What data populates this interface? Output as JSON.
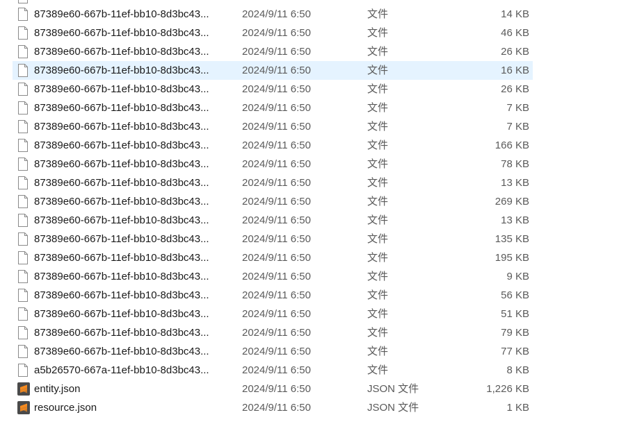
{
  "files": [
    {
      "name": "",
      "date": "",
      "type": "",
      "size": "",
      "icon": "document-icon",
      "partial": true
    },
    {
      "name": "87389e60-667b-11ef-bb10-8d3bc43...",
      "date": "2024/9/11 6:50",
      "type": "文件",
      "size": "14 KB",
      "icon": "document-icon"
    },
    {
      "name": "87389e60-667b-11ef-bb10-8d3bc43...",
      "date": "2024/9/11 6:50",
      "type": "文件",
      "size": "46 KB",
      "icon": "document-icon"
    },
    {
      "name": "87389e60-667b-11ef-bb10-8d3bc43...",
      "date": "2024/9/11 6:50",
      "type": "文件",
      "size": "26 KB",
      "icon": "document-icon"
    },
    {
      "name": "87389e60-667b-11ef-bb10-8d3bc43...",
      "date": "2024/9/11 6:50",
      "type": "文件",
      "size": "16 KB",
      "icon": "document-icon",
      "selected": true
    },
    {
      "name": "87389e60-667b-11ef-bb10-8d3bc43...",
      "date": "2024/9/11 6:50",
      "type": "文件",
      "size": "26 KB",
      "icon": "document-icon"
    },
    {
      "name": "87389e60-667b-11ef-bb10-8d3bc43...",
      "date": "2024/9/11 6:50",
      "type": "文件",
      "size": "7 KB",
      "icon": "document-icon"
    },
    {
      "name": "87389e60-667b-11ef-bb10-8d3bc43...",
      "date": "2024/9/11 6:50",
      "type": "文件",
      "size": "7 KB",
      "icon": "document-icon"
    },
    {
      "name": "87389e60-667b-11ef-bb10-8d3bc43...",
      "date": "2024/9/11 6:50",
      "type": "文件",
      "size": "166 KB",
      "icon": "document-icon"
    },
    {
      "name": "87389e60-667b-11ef-bb10-8d3bc43...",
      "date": "2024/9/11 6:50",
      "type": "文件",
      "size": "78 KB",
      "icon": "document-icon"
    },
    {
      "name": "87389e60-667b-11ef-bb10-8d3bc43...",
      "date": "2024/9/11 6:50",
      "type": "文件",
      "size": "13 KB",
      "icon": "document-icon"
    },
    {
      "name": "87389e60-667b-11ef-bb10-8d3bc43...",
      "date": "2024/9/11 6:50",
      "type": "文件",
      "size": "269 KB",
      "icon": "document-icon"
    },
    {
      "name": "87389e60-667b-11ef-bb10-8d3bc43...",
      "date": "2024/9/11 6:50",
      "type": "文件",
      "size": "13 KB",
      "icon": "document-icon"
    },
    {
      "name": "87389e60-667b-11ef-bb10-8d3bc43...",
      "date": "2024/9/11 6:50",
      "type": "文件",
      "size": "135 KB",
      "icon": "document-icon"
    },
    {
      "name": "87389e60-667b-11ef-bb10-8d3bc43...",
      "date": "2024/9/11 6:50",
      "type": "文件",
      "size": "195 KB",
      "icon": "document-icon"
    },
    {
      "name": "87389e60-667b-11ef-bb10-8d3bc43...",
      "date": "2024/9/11 6:50",
      "type": "文件",
      "size": "9 KB",
      "icon": "document-icon"
    },
    {
      "name": "87389e60-667b-11ef-bb10-8d3bc43...",
      "date": "2024/9/11 6:50",
      "type": "文件",
      "size": "56 KB",
      "icon": "document-icon"
    },
    {
      "name": "87389e60-667b-11ef-bb10-8d3bc43...",
      "date": "2024/9/11 6:50",
      "type": "文件",
      "size": "51 KB",
      "icon": "document-icon"
    },
    {
      "name": "87389e60-667b-11ef-bb10-8d3bc43...",
      "date": "2024/9/11 6:50",
      "type": "文件",
      "size": "79 KB",
      "icon": "document-icon"
    },
    {
      "name": "87389e60-667b-11ef-bb10-8d3bc43...",
      "date": "2024/9/11 6:50",
      "type": "文件",
      "size": "77 KB",
      "icon": "document-icon"
    },
    {
      "name": "a5b26570-667a-11ef-bb10-8d3bc43...",
      "date": "2024/9/11 6:50",
      "type": "文件",
      "size": "8 KB",
      "icon": "document-icon"
    },
    {
      "name": "entity.json",
      "date": "2024/9/11 6:50",
      "type": "JSON 文件",
      "size": "1,226 KB",
      "icon": "sublime-text-icon"
    },
    {
      "name": "resource.json",
      "date": "2024/9/11 6:50",
      "type": "JSON 文件",
      "size": "1 KB",
      "icon": "sublime-text-icon"
    }
  ],
  "colors": {
    "selected_row": "#e5f3ff",
    "secondary_text": "#5a5a5a",
    "json_icon": "#f58a1f",
    "json_icon_bg": "#4a4a4a"
  }
}
